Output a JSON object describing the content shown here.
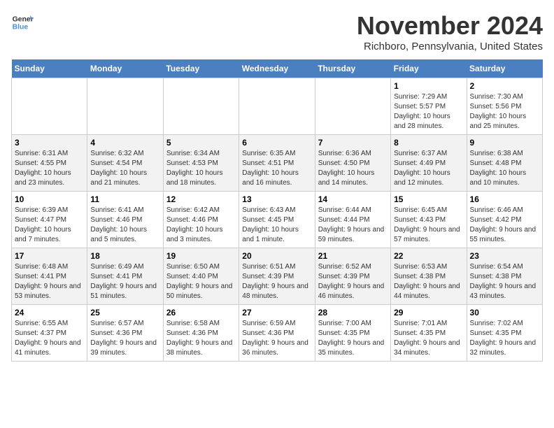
{
  "header": {
    "logo_line1": "General",
    "logo_line2": "Blue",
    "month": "November 2024",
    "location": "Richboro, Pennsylvania, United States"
  },
  "days_of_week": [
    "Sunday",
    "Monday",
    "Tuesday",
    "Wednesday",
    "Thursday",
    "Friday",
    "Saturday"
  ],
  "weeks": [
    [
      {
        "day": "",
        "info": ""
      },
      {
        "day": "",
        "info": ""
      },
      {
        "day": "",
        "info": ""
      },
      {
        "day": "",
        "info": ""
      },
      {
        "day": "",
        "info": ""
      },
      {
        "day": "1",
        "info": "Sunrise: 7:29 AM\nSunset: 5:57 PM\nDaylight: 10 hours and 28 minutes."
      },
      {
        "day": "2",
        "info": "Sunrise: 7:30 AM\nSunset: 5:56 PM\nDaylight: 10 hours and 25 minutes."
      }
    ],
    [
      {
        "day": "3",
        "info": "Sunrise: 6:31 AM\nSunset: 4:55 PM\nDaylight: 10 hours and 23 minutes."
      },
      {
        "day": "4",
        "info": "Sunrise: 6:32 AM\nSunset: 4:54 PM\nDaylight: 10 hours and 21 minutes."
      },
      {
        "day": "5",
        "info": "Sunrise: 6:34 AM\nSunset: 4:53 PM\nDaylight: 10 hours and 18 minutes."
      },
      {
        "day": "6",
        "info": "Sunrise: 6:35 AM\nSunset: 4:51 PM\nDaylight: 10 hours and 16 minutes."
      },
      {
        "day": "7",
        "info": "Sunrise: 6:36 AM\nSunset: 4:50 PM\nDaylight: 10 hours and 14 minutes."
      },
      {
        "day": "8",
        "info": "Sunrise: 6:37 AM\nSunset: 4:49 PM\nDaylight: 10 hours and 12 minutes."
      },
      {
        "day": "9",
        "info": "Sunrise: 6:38 AM\nSunset: 4:48 PM\nDaylight: 10 hours and 10 minutes."
      }
    ],
    [
      {
        "day": "10",
        "info": "Sunrise: 6:39 AM\nSunset: 4:47 PM\nDaylight: 10 hours and 7 minutes."
      },
      {
        "day": "11",
        "info": "Sunrise: 6:41 AM\nSunset: 4:46 PM\nDaylight: 10 hours and 5 minutes."
      },
      {
        "day": "12",
        "info": "Sunrise: 6:42 AM\nSunset: 4:46 PM\nDaylight: 10 hours and 3 minutes."
      },
      {
        "day": "13",
        "info": "Sunrise: 6:43 AM\nSunset: 4:45 PM\nDaylight: 10 hours and 1 minute."
      },
      {
        "day": "14",
        "info": "Sunrise: 6:44 AM\nSunset: 4:44 PM\nDaylight: 9 hours and 59 minutes."
      },
      {
        "day": "15",
        "info": "Sunrise: 6:45 AM\nSunset: 4:43 PM\nDaylight: 9 hours and 57 minutes."
      },
      {
        "day": "16",
        "info": "Sunrise: 6:46 AM\nSunset: 4:42 PM\nDaylight: 9 hours and 55 minutes."
      }
    ],
    [
      {
        "day": "17",
        "info": "Sunrise: 6:48 AM\nSunset: 4:41 PM\nDaylight: 9 hours and 53 minutes."
      },
      {
        "day": "18",
        "info": "Sunrise: 6:49 AM\nSunset: 4:41 PM\nDaylight: 9 hours and 51 minutes."
      },
      {
        "day": "19",
        "info": "Sunrise: 6:50 AM\nSunset: 4:40 PM\nDaylight: 9 hours and 50 minutes."
      },
      {
        "day": "20",
        "info": "Sunrise: 6:51 AM\nSunset: 4:39 PM\nDaylight: 9 hours and 48 minutes."
      },
      {
        "day": "21",
        "info": "Sunrise: 6:52 AM\nSunset: 4:39 PM\nDaylight: 9 hours and 46 minutes."
      },
      {
        "day": "22",
        "info": "Sunrise: 6:53 AM\nSunset: 4:38 PM\nDaylight: 9 hours and 44 minutes."
      },
      {
        "day": "23",
        "info": "Sunrise: 6:54 AM\nSunset: 4:38 PM\nDaylight: 9 hours and 43 minutes."
      }
    ],
    [
      {
        "day": "24",
        "info": "Sunrise: 6:55 AM\nSunset: 4:37 PM\nDaylight: 9 hours and 41 minutes."
      },
      {
        "day": "25",
        "info": "Sunrise: 6:57 AM\nSunset: 4:36 PM\nDaylight: 9 hours and 39 minutes."
      },
      {
        "day": "26",
        "info": "Sunrise: 6:58 AM\nSunset: 4:36 PM\nDaylight: 9 hours and 38 minutes."
      },
      {
        "day": "27",
        "info": "Sunrise: 6:59 AM\nSunset: 4:36 PM\nDaylight: 9 hours and 36 minutes."
      },
      {
        "day": "28",
        "info": "Sunrise: 7:00 AM\nSunset: 4:35 PM\nDaylight: 9 hours and 35 minutes."
      },
      {
        "day": "29",
        "info": "Sunrise: 7:01 AM\nSunset: 4:35 PM\nDaylight: 9 hours and 34 minutes."
      },
      {
        "day": "30",
        "info": "Sunrise: 7:02 AM\nSunset: 4:35 PM\nDaylight: 9 hours and 32 minutes."
      }
    ]
  ]
}
